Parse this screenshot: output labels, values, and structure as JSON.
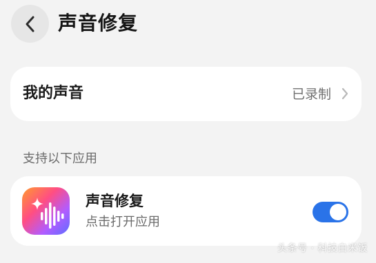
{
  "header": {
    "title": "声音修复",
    "back_icon": "chevron-left-icon"
  },
  "my_voice": {
    "label": "我的声音",
    "status": "已录制",
    "chevron_icon": "chevron-right-icon"
  },
  "section": {
    "title": "支持以下应用"
  },
  "app": {
    "name": "声音修复",
    "subtitle": "点击打开应用",
    "icon": "sparkle-waveform-icon",
    "toggle_on": true,
    "toggle_color": "#2a73e8"
  },
  "watermark": {
    "text": "头条号 · 科技白米饭"
  }
}
